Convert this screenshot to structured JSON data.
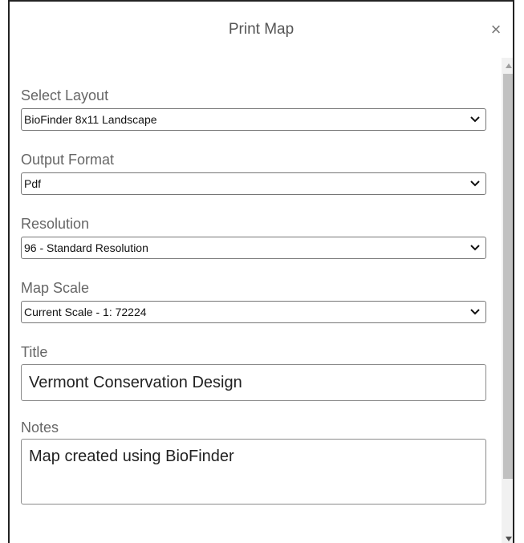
{
  "dialog": {
    "title": "Print Map",
    "close_label": "×"
  },
  "fields": {
    "layout": {
      "label": "Select Layout",
      "value": "BioFinder 8x11 Landscape"
    },
    "format": {
      "label": "Output Format",
      "value": "Pdf"
    },
    "resolution": {
      "label": "Resolution",
      "value": "96 - Standard Resolution"
    },
    "scale": {
      "label": "Map Scale",
      "value": "Current Scale - 1: 72224"
    },
    "title": {
      "label": "Title",
      "value": "Vermont Conservation Design"
    },
    "notes": {
      "label": "Notes",
      "value": "Map created using BioFinder"
    }
  },
  "icons": {
    "close": "close-icon",
    "dropdown": "chevron-down-icon",
    "scroll_up": "scroll-up-arrow-icon",
    "scroll_down": "scroll-down-arrow-icon"
  }
}
